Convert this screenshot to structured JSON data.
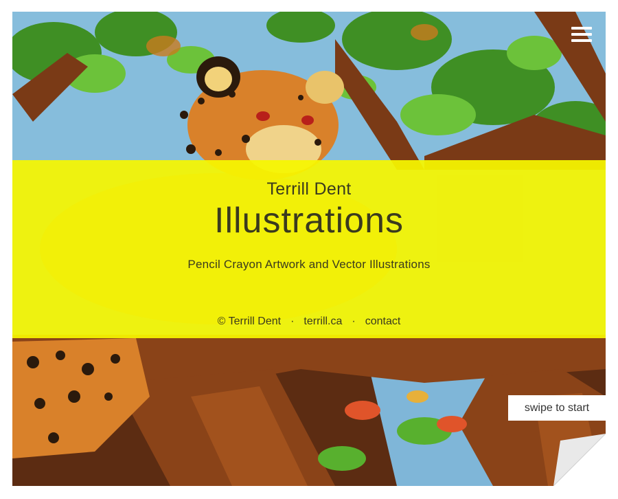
{
  "menu": {
    "icon": "hamburger-menu-icon"
  },
  "title_band": {
    "author": "Terrill Dent",
    "heading": "Illustrations",
    "subtitle": "Pencil Crayon Artwork and Vector Illustrations"
  },
  "footer": {
    "copyright": "© Terrill Dent",
    "separator": "·",
    "site_link": "terrill.ca",
    "contact_link": "contact"
  },
  "swipe": {
    "label": "swipe to start"
  },
  "colors": {
    "band": "#f6f600",
    "text": "#3a3a1e",
    "sky": "#7fb6d8",
    "leaf": "#4f9e2a",
    "branch": "#6b3414",
    "jaguar": "#d9812a"
  }
}
